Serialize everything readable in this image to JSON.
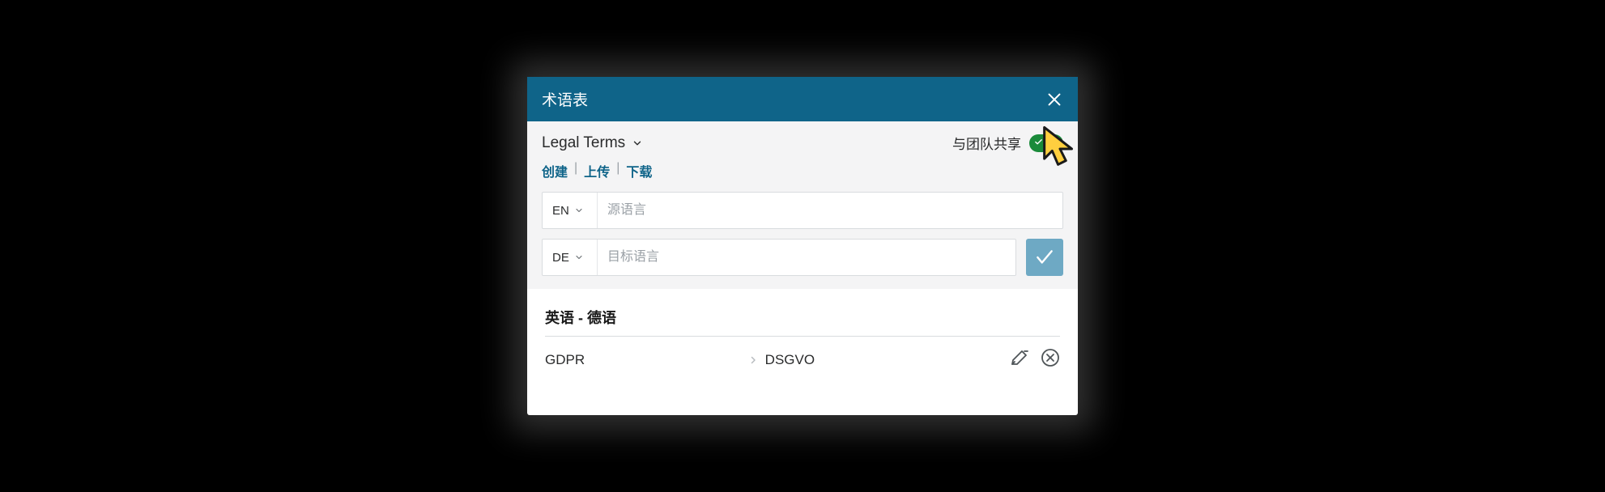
{
  "dialog": {
    "title": "术语表",
    "glossary_name": "Legal Terms",
    "share_label": "与团队共享",
    "share_on": true,
    "actions": {
      "create": "创建",
      "upload": "上传",
      "download": "下载"
    },
    "source_lang": "EN",
    "target_lang": "DE",
    "source_placeholder": "源语言",
    "target_placeholder": "目标语言"
  },
  "terms": {
    "heading": "英语 - 德语",
    "rows": [
      {
        "source": "GDPR",
        "target": "DSGVO"
      }
    ]
  },
  "icons": {
    "close": "close-icon",
    "chevron_down": "chevron-down-icon",
    "check": "check-icon",
    "edit": "edit-icon",
    "delete": "delete-circle-icon",
    "arrow_right": "chevron-right-icon",
    "cursor": "cursor-pointer-icon"
  },
  "colors": {
    "header_bg": "#0f6489",
    "action_link": "#0f6489",
    "toggle_on": "#1a8a3a",
    "confirm_btn": "#6ea9c4",
    "cursor_fill": "#ffcf3f",
    "cursor_stroke": "#1a1a1a"
  }
}
